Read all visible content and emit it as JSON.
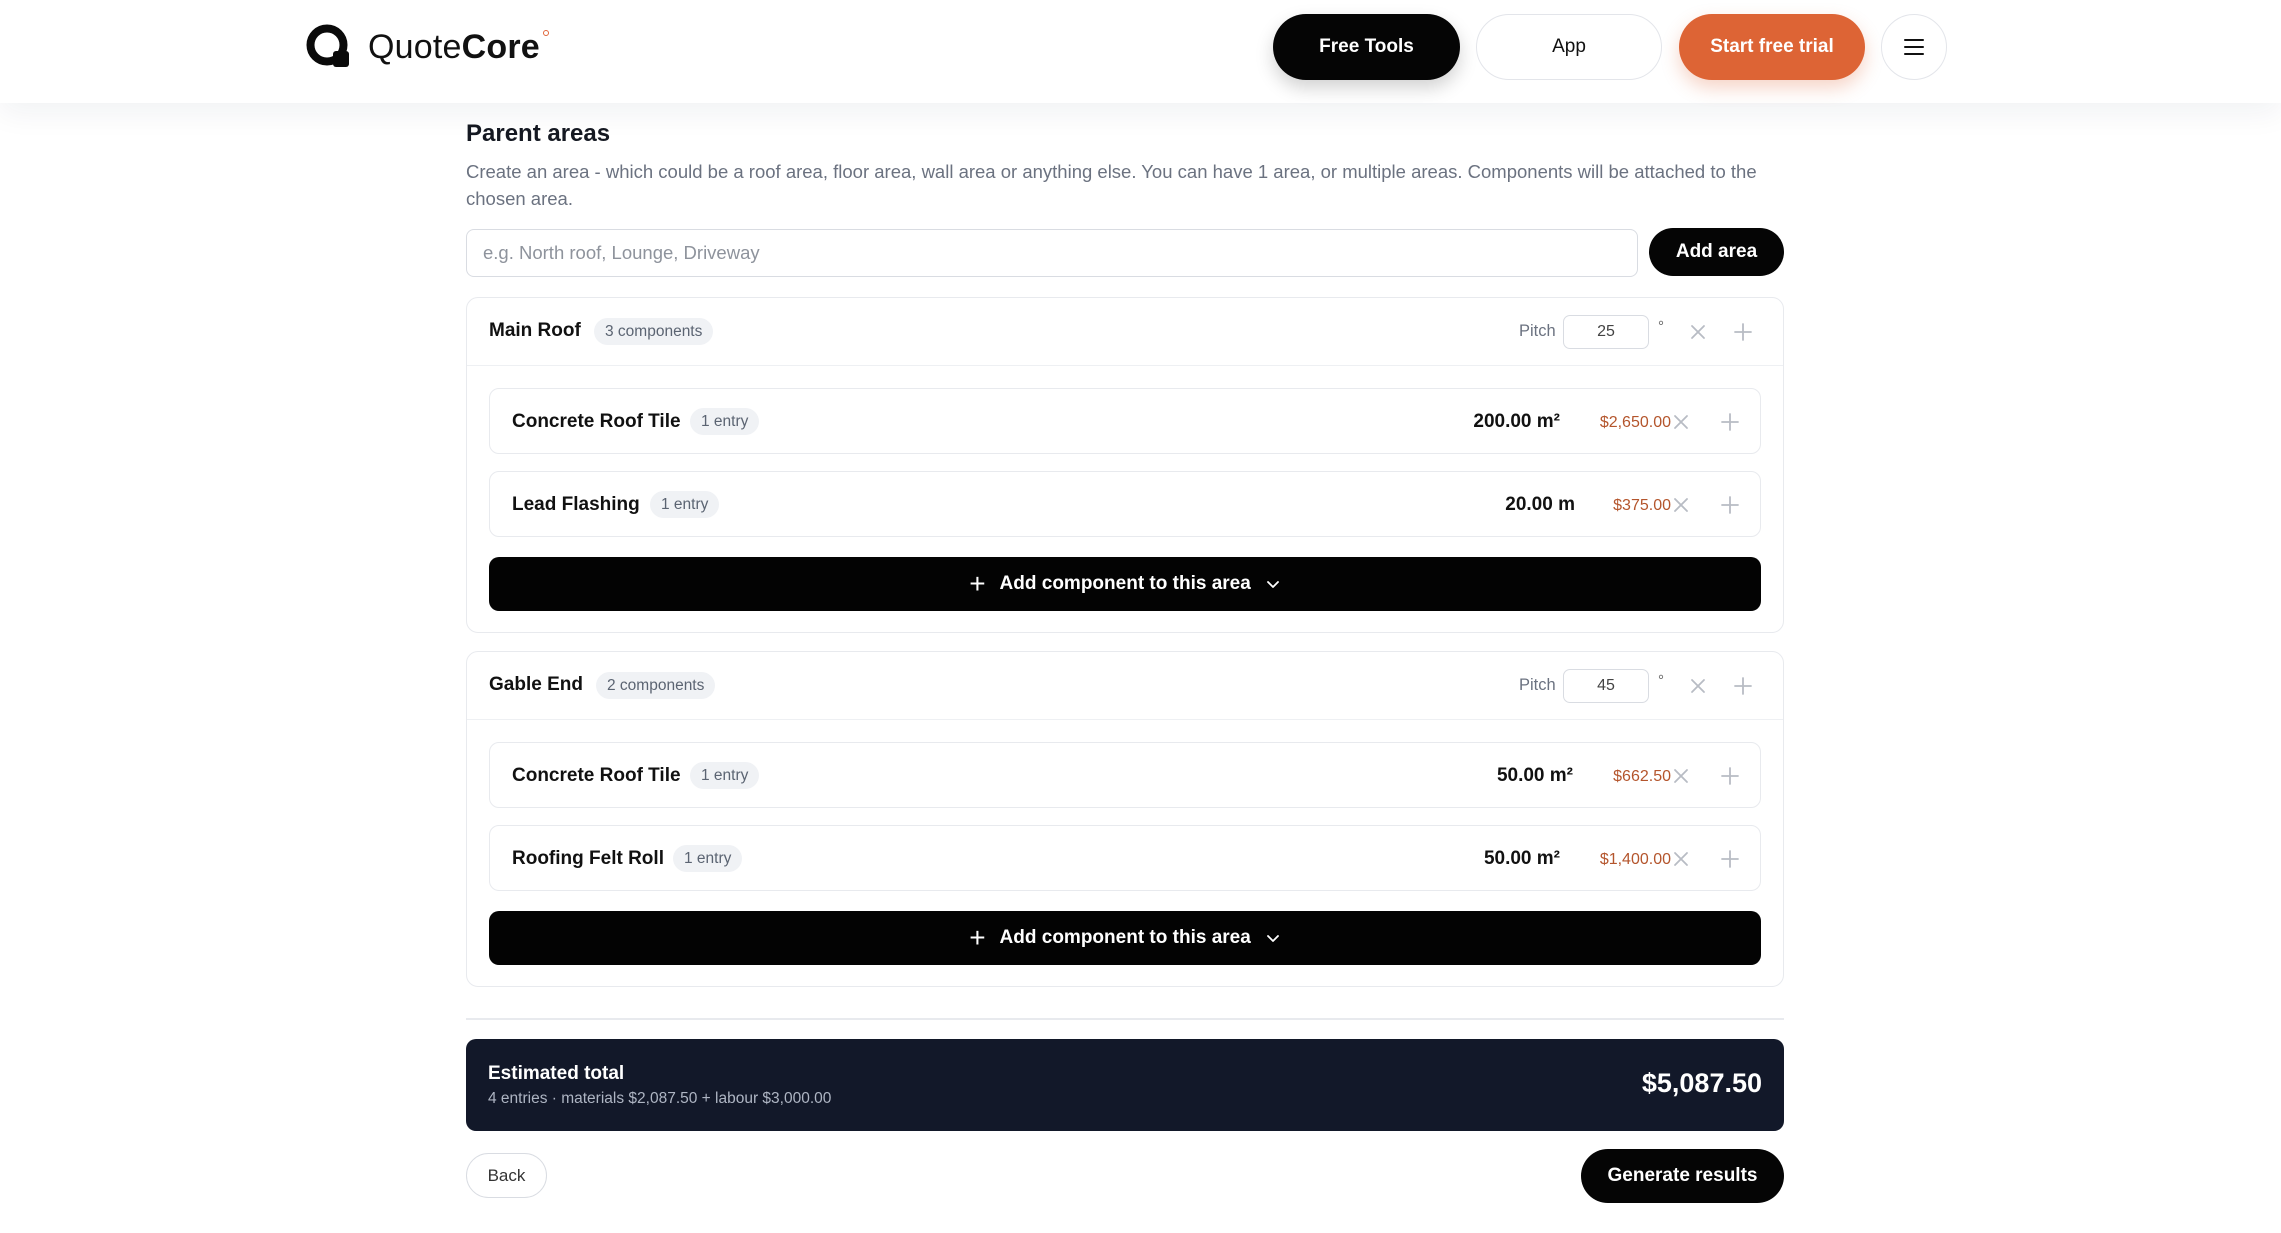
{
  "header": {
    "brand": {
      "light": "Quote",
      "bold": "Core"
    },
    "nav": {
      "free_tools": "Free Tools",
      "app": "App",
      "start_trial": "Start free trial"
    },
    "menu_icon": "hamburger-menu-icon"
  },
  "colors": {
    "accent_orange": "#dd6435",
    "price_text": "#b4552c",
    "total_bg": "#121829",
    "button_black": "#050505"
  },
  "section": {
    "title": "Parent areas",
    "description": "Create an area - which could be a roof area, floor area, wall area or anything else. You can have 1 area, or multiple areas. Components will be attached to the chosen area.",
    "input_placeholder": "e.g. North roof, Lounge, Driveway",
    "input_value": "",
    "add_area_label": "Add area"
  },
  "areas": [
    {
      "name": "Main Roof",
      "count_badge": "3 components",
      "pitch_label": "Pitch",
      "pitch_value": "25",
      "degree": "°",
      "components": [
        {
          "name": "Concrete Roof Tile",
          "entries": "1 entry",
          "qty": "200.00 m²",
          "price": "$2,650.00"
        },
        {
          "name": "Lead Flashing",
          "entries": "1 entry",
          "qty": "20.00 m",
          "price": "$375.00"
        }
      ],
      "add_component_label": "Add component to this area"
    },
    {
      "name": "Gable End",
      "count_badge": "2 components",
      "pitch_label": "Pitch",
      "pitch_value": "45",
      "degree": "°",
      "components": [
        {
          "name": "Concrete Roof Tile",
          "entries": "1 entry",
          "qty": "50.00 m²",
          "price": "$662.50"
        },
        {
          "name": "Roofing Felt Roll",
          "entries": "1 entry",
          "qty": "50.00 m²",
          "price": "$1,400.00"
        }
      ],
      "add_component_label": "Add component to this area"
    }
  ],
  "total": {
    "title": "Estimated total",
    "summary": "4 entries · materials $2,087.50 + labour $3,000.00",
    "amount": "$5,087.50"
  },
  "footer": {
    "back_label": "Back",
    "generate_label": "Generate results"
  }
}
